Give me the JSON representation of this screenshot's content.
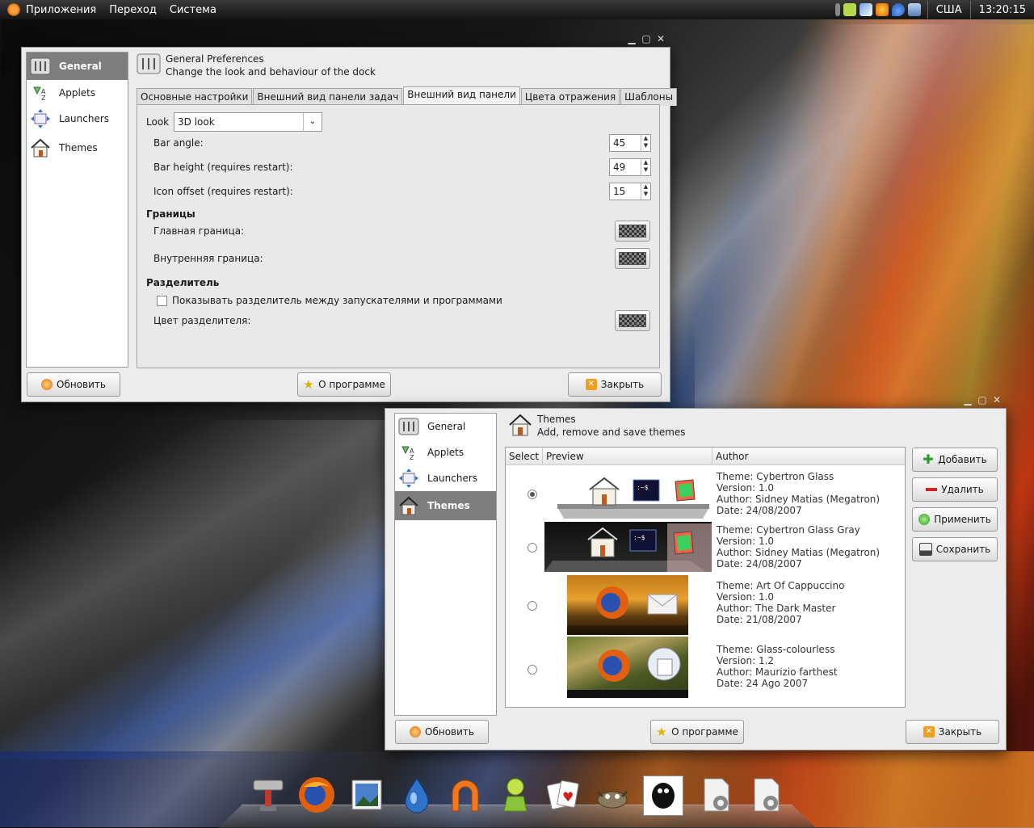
{
  "top_panel": {
    "menus": [
      "Приложения",
      "Переход",
      "Система"
    ],
    "keyboard_layout": "США",
    "clock": "13:20:15"
  },
  "prefs_window": {
    "sidebar": [
      {
        "label": "General",
        "icon": "general-icon",
        "selected": true
      },
      {
        "label": "Applets",
        "icon": "applets-icon",
        "selected": false
      },
      {
        "label": "Launchers",
        "icon": "launchers-icon",
        "selected": false
      },
      {
        "label": "Themes",
        "icon": "home-icon",
        "selected": false
      }
    ],
    "header_title": "General Preferences",
    "header_subtitle": "Change the look and behaviour of the dock",
    "tabs": [
      "Основные настройки",
      "Внешний вид панели задач",
      "Внешний вид панели",
      "Цвета отражения",
      "Шаблоны"
    ],
    "active_tab": 2,
    "look_label": "Look",
    "look_value": "3D look",
    "bar_angle_label": "Bar angle:",
    "bar_angle_value": "45",
    "bar_height_label": "Bar height (requires restart):",
    "bar_height_value": "49",
    "icon_offset_label": "Icon offset (requires restart):",
    "icon_offset_value": "15",
    "borders_section": "Границы",
    "main_border_label": "Главная граница:",
    "inner_border_label": "Внутренняя граница:",
    "separator_section": "Разделитель",
    "show_separator_label": "Показывать разделитель между запускателями и программами",
    "separator_color_label": "Цвет разделителя:",
    "refresh_button": "Обновить",
    "about_button": "О программе",
    "close_button": "Закрыть"
  },
  "themes_window": {
    "sidebar": [
      {
        "label": "General",
        "icon": "general-icon",
        "selected": false
      },
      {
        "label": "Applets",
        "icon": "applets-icon",
        "selected": false
      },
      {
        "label": "Launchers",
        "icon": "launchers-icon",
        "selected": false
      },
      {
        "label": "Themes",
        "icon": "home-icon",
        "selected": true
      }
    ],
    "header_title": "Themes",
    "header_subtitle": "Add, remove and save themes",
    "columns": [
      "Select",
      "Preview",
      "Author"
    ],
    "themes": [
      {
        "selected": true,
        "theme": "Theme: Cybertron Glass",
        "version": "Version: 1.0",
        "author": "Author: Sidney Matias (Megatron)",
        "date": "Date: 24/08/2007"
      },
      {
        "selected": false,
        "theme": "Theme: Cybertron Glass Gray",
        "version": "Version: 1.0",
        "author": "Author: Sidney Matias (Megatron)",
        "date": "Date: 24/08/2007"
      },
      {
        "selected": false,
        "theme": "Theme: Art Of Cappuccino",
        "version": "Version: 1.0",
        "author": "Author: The Dark Master",
        "date": "Date: 21/08/2007"
      },
      {
        "selected": false,
        "theme": "Theme: Glass-colourless",
        "version": "Version: 1.2",
        "author": "Author: Maurizio farthest",
        "date": "Date: 24 Ago 2007"
      }
    ],
    "add_button": "Добавить",
    "remove_button": "Удалить",
    "apply_button": "Применить",
    "save_button": "Сохранить",
    "refresh_button": "Обновить",
    "about_button": "О программе",
    "close_button": "Закрыть"
  },
  "dock_icons": [
    "toolbox-icon",
    "firefox-icon",
    "image-viewer-icon",
    "drop-icon",
    "magnet-icon",
    "pidgin-icon",
    "solitaire-icon",
    "gimp-icon",
    "terminal-penguin-icon",
    "settings-document-icon",
    "settings-document-icon"
  ]
}
